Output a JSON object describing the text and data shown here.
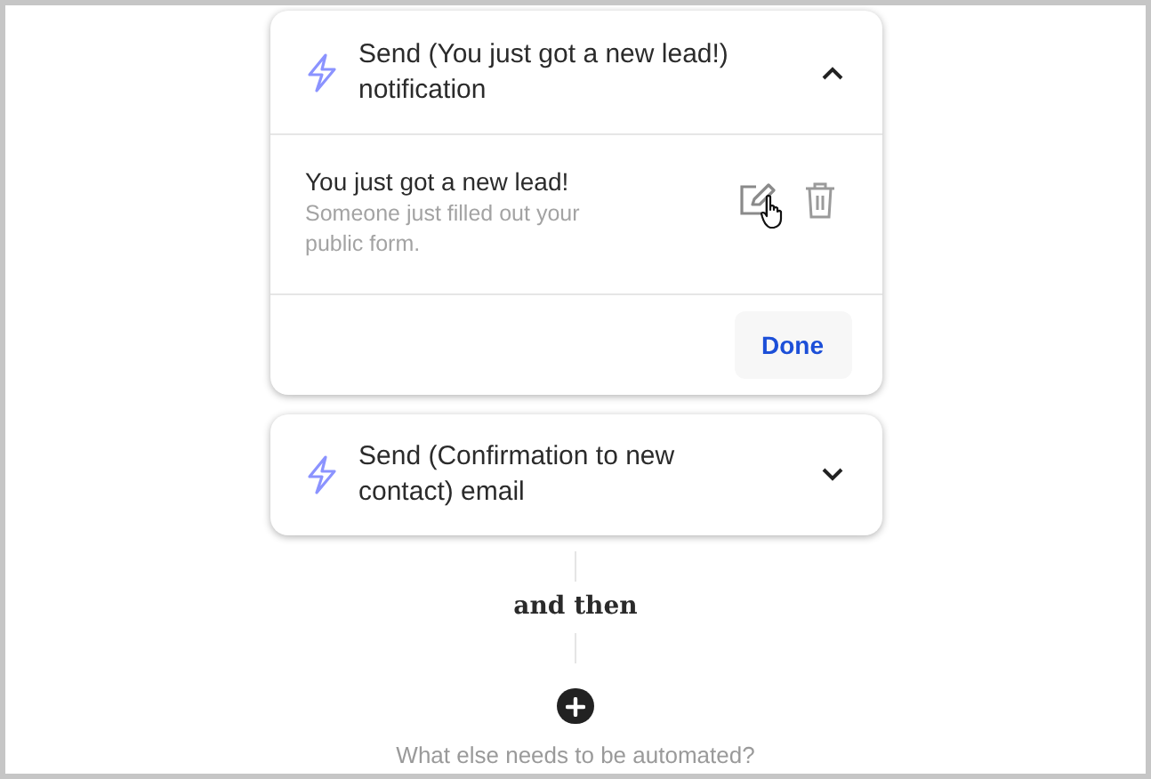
{
  "actions": [
    {
      "title": "Send (You just got a new lead!) notification",
      "expanded": true,
      "message": {
        "title": "You just got a new lead!",
        "body": "Someone just filled out your public form."
      },
      "done_label": "Done"
    },
    {
      "title": "Send (Confirmation to new contact) email",
      "expanded": false
    }
  ],
  "connector_label": "and then",
  "prompt": "What else needs to be automated?"
}
